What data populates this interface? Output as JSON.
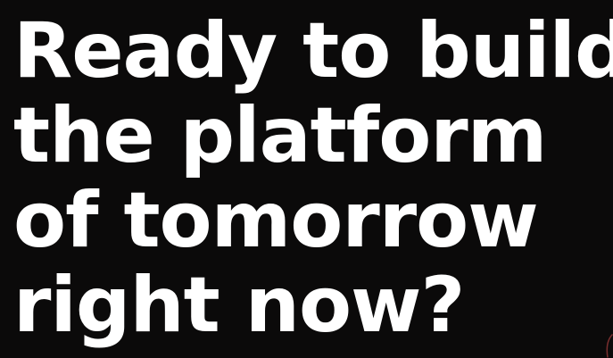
{
  "hero": {
    "headline_lines": [
      "Ready to build",
      "the platform",
      "of tomorrow",
      "right now?"
    ]
  },
  "colors": {
    "background": "#0b0a0a",
    "text": "#ffffff",
    "accent": "#7a2e2e"
  }
}
